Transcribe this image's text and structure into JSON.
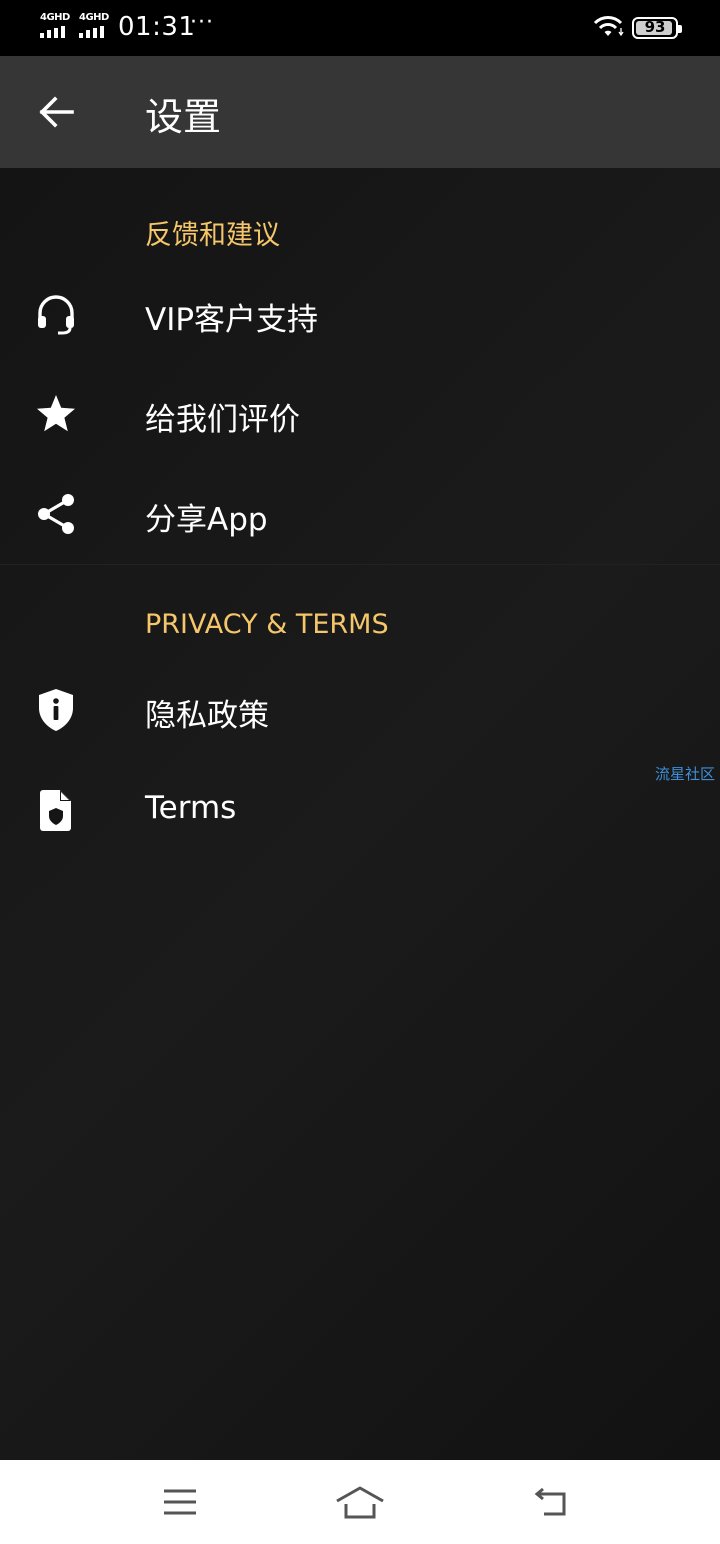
{
  "status_bar": {
    "network_1": "4GHD",
    "network_2": "4GHD",
    "time": "01:31",
    "more": "···",
    "battery": "93"
  },
  "app_bar": {
    "title": "设置",
    "back_icon": "arrow-left-icon"
  },
  "sections": [
    {
      "header": "反馈和建议",
      "items": [
        {
          "label": "VIP客户支持",
          "icon": "headset-icon"
        },
        {
          "label": "给我们评价",
          "icon": "star-icon"
        },
        {
          "label": "分享App",
          "icon": "share-icon"
        }
      ]
    },
    {
      "header": "PRIVACY & TERMS",
      "items": [
        {
          "label": "隐私政策",
          "icon": "shield-info-icon"
        },
        {
          "label": "Terms",
          "icon": "document-shield-icon"
        }
      ]
    }
  ],
  "watermark": "流星社区",
  "colors": {
    "accent": "#f5c66a",
    "app_bar": "#363636",
    "background": "#151515"
  },
  "nav_bar": {
    "menu_icon": "menu-icon",
    "home_icon": "home-icon",
    "back_icon": "return-icon"
  }
}
